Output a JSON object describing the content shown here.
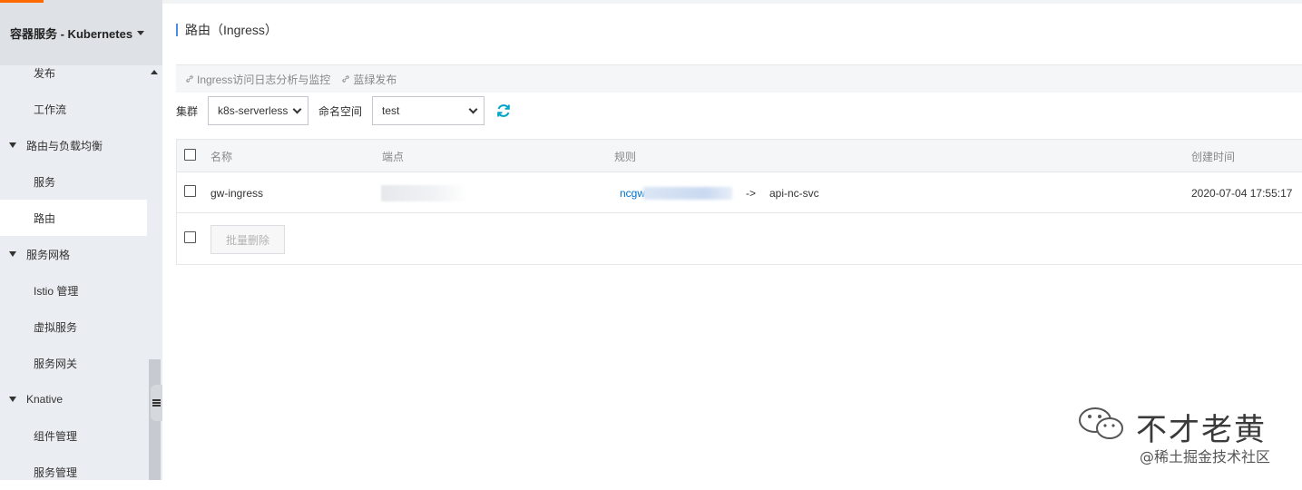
{
  "sidebar": {
    "title": "容器服务 - Kubernetes",
    "items": [
      {
        "label": "发布",
        "type": "child"
      },
      {
        "label": "工作流",
        "type": "child"
      },
      {
        "label": "路由与负载均衡",
        "type": "group"
      },
      {
        "label": "服务",
        "type": "child"
      },
      {
        "label": "路由",
        "type": "child",
        "active": true
      },
      {
        "label": "服务网格",
        "type": "group"
      },
      {
        "label": "Istio 管理",
        "type": "child"
      },
      {
        "label": "虚拟服务",
        "type": "child"
      },
      {
        "label": "服务网关",
        "type": "child"
      },
      {
        "label": "Knative",
        "type": "group"
      },
      {
        "label": "组件管理",
        "type": "child"
      },
      {
        "label": "服务管理",
        "type": "child"
      }
    ]
  },
  "page": {
    "title": "路由（Ingress）"
  },
  "links": {
    "log_analysis": "Ingress访问日志分析与监控",
    "blue_green": "蓝绿发布"
  },
  "filters": {
    "cluster_label": "集群",
    "cluster_value": "k8s-serverless",
    "namespace_label": "命名空间",
    "namespace_value": "test"
  },
  "table": {
    "headers": {
      "name": "名称",
      "endpoint": "端点",
      "rules": "规则",
      "created": "创建时间"
    },
    "rows": [
      {
        "name": "gw-ingress",
        "rule_host": "ncgw",
        "rule_arrow": "->",
        "rule_service": "api-nc-svc",
        "created": "2020-07-04 17:55:17"
      }
    ],
    "bulk_delete": "批量删除"
  },
  "watermark": {
    "name": "不才老黄",
    "sub": "@稀土掘金技术社区"
  },
  "colors": {
    "sidebar_bg": "#eaedf1",
    "accent": "#ff6a00",
    "link_blue": "#0070cc",
    "refresh_teal": "#00a5c7"
  }
}
